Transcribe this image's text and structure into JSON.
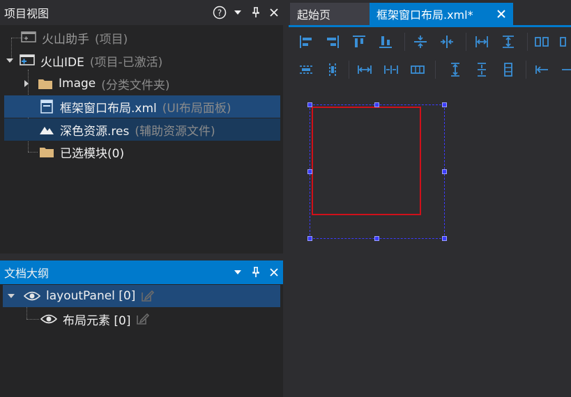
{
  "project_panel": {
    "title": "项目视图",
    "items": [
      {
        "label": "火山助手",
        "note": "(项目)"
      },
      {
        "label": "火山IDE",
        "note": "(项目-已激活)"
      },
      {
        "label": "Image",
        "note": "(分类文件夹)"
      },
      {
        "label": "框架窗口布局.xml",
        "note": "(UI布局面板)"
      },
      {
        "label": "深色资源.res",
        "note": "(辅助资源文件)"
      },
      {
        "label": "已选模块(0)",
        "note": ""
      }
    ]
  },
  "outline_panel": {
    "title": "文档大纲",
    "items": [
      {
        "label": "layoutPanel [0]"
      },
      {
        "label": "布局元素 [0]"
      }
    ]
  },
  "editor": {
    "tabs": [
      {
        "label": "起始页"
      },
      {
        "label": "框架窗口布局.xml*"
      }
    ]
  },
  "icons": {
    "help": "help-icon",
    "dropdown": "dropdown-icon",
    "pin": "pin-icon",
    "close": "close-icon"
  },
  "colors": {
    "accent": "#007acc",
    "selection": "#1f4a7a",
    "toolbar_icon": "#3a8fd6",
    "selection_box": "#3c3cff",
    "element_border": "#d0101a"
  }
}
